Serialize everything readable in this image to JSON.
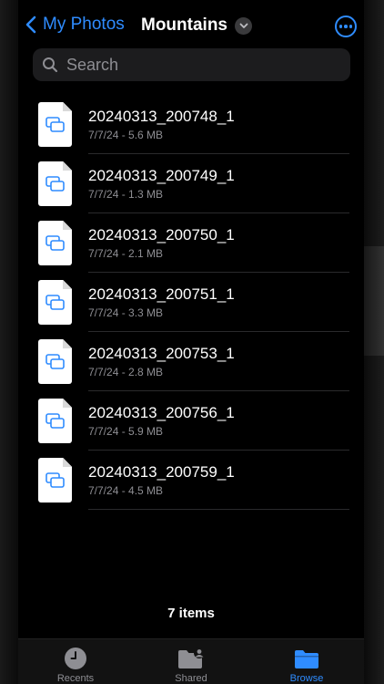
{
  "header": {
    "back_label": "My Photos",
    "title": "Mountains",
    "title_icon": "chevron-down-icon",
    "more_icon": "ellipsis-circle-icon"
  },
  "search": {
    "placeholder": "Search",
    "value": ""
  },
  "files": [
    {
      "name": "20240313_200748_1",
      "meta": "7/7/24 - 5.6 MB"
    },
    {
      "name": "20240313_200749_1",
      "meta": "7/7/24 - 1.3 MB"
    },
    {
      "name": "20240313_200750_1",
      "meta": "7/7/24 - 2.1 MB"
    },
    {
      "name": "20240313_200751_1",
      "meta": "7/7/24 - 3.3 MB"
    },
    {
      "name": "20240313_200753_1",
      "meta": "7/7/24 - 2.8 MB"
    },
    {
      "name": "20240313_200756_1",
      "meta": "7/7/24 - 5.9 MB"
    },
    {
      "name": "20240313_200759_1",
      "meta": "7/7/24 - 4.5 MB"
    }
  ],
  "footer": {
    "count": "7 items"
  },
  "tabs": [
    {
      "label": "Recents",
      "icon": "clock-icon",
      "active": false
    },
    {
      "label": "Shared",
      "icon": "shared-folder-icon",
      "active": false
    },
    {
      "label": "Browse",
      "icon": "folder-icon",
      "active": true
    }
  ],
  "colors": {
    "accent": "#2f8cff",
    "background": "#000000",
    "secondary_text": "#8e8e93"
  }
}
